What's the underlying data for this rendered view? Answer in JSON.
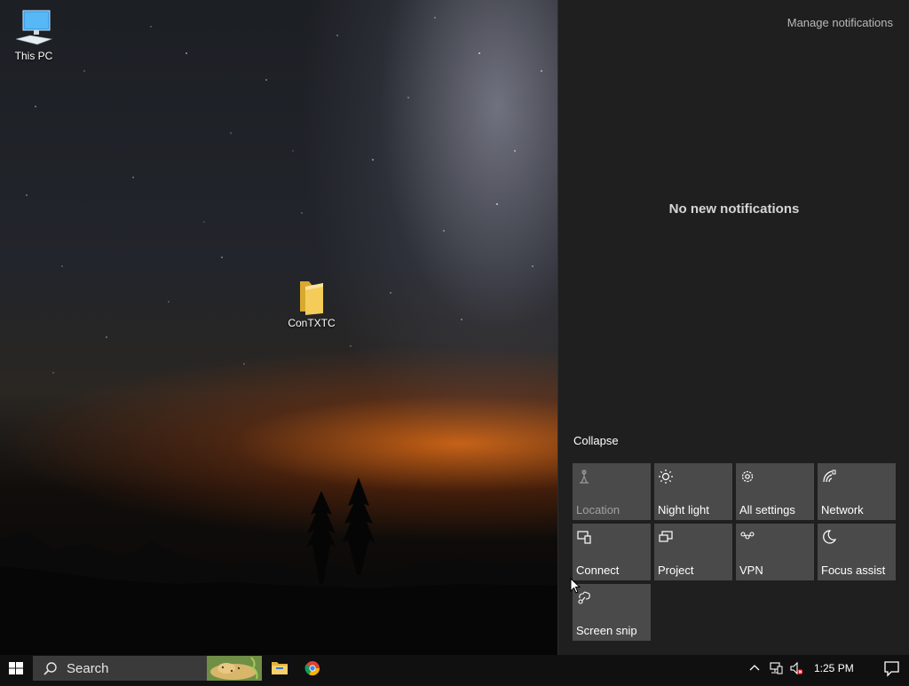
{
  "desktop": {
    "icons": [
      {
        "label": "This PC",
        "icon": "computer-icon"
      },
      {
        "label": "ConTXTC",
        "icon": "folder-icon"
      }
    ]
  },
  "action_center": {
    "manage_label": "Manage notifications",
    "empty_text": "No new notifications",
    "collapse_label": "Collapse",
    "tiles": [
      {
        "label": "Location",
        "icon": "location-icon",
        "enabled": false
      },
      {
        "label": "Night light",
        "icon": "night-light-icon",
        "enabled": true
      },
      {
        "label": "All settings",
        "icon": "gear-icon",
        "enabled": true
      },
      {
        "label": "Network",
        "icon": "network-icon",
        "enabled": true
      },
      {
        "label": "Connect",
        "icon": "connect-icon",
        "enabled": true
      },
      {
        "label": "Project",
        "icon": "project-icon",
        "enabled": true
      },
      {
        "label": "VPN",
        "icon": "vpn-icon",
        "enabled": true
      },
      {
        "label": "Focus assist",
        "icon": "moon-icon",
        "enabled": true
      },
      {
        "label": "Screen snip",
        "icon": "screen-snip-icon",
        "enabled": true
      }
    ]
  },
  "taskbar": {
    "search_label": "Search",
    "pinned": [
      "file-explorer-icon",
      "chrome-icon"
    ],
    "tray_icons": [
      "chevron-up-icon",
      "network-wired-icon",
      "volume-muted-icon"
    ],
    "time": "1:25 PM"
  },
  "colors": {
    "action_center_bg": "#1f1f1f",
    "tile_bg": "#4a4a4a",
    "taskbar_bg": "#101010",
    "search_bg": "#3a3a3a"
  }
}
